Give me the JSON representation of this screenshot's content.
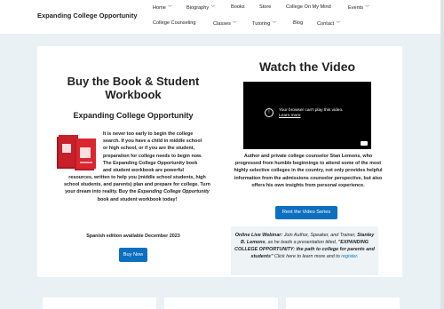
{
  "site": {
    "title": "Expanding College Opportunity"
  },
  "nav": {
    "row1": [
      {
        "label": "Home",
        "dropdown": true
      },
      {
        "label": "Biography",
        "dropdown": true
      },
      {
        "label": "Books",
        "dropdown": false
      },
      {
        "label": "Store",
        "dropdown": false
      },
      {
        "label": "College On My Mind",
        "dropdown": false
      },
      {
        "label": "Events",
        "dropdown": true
      }
    ],
    "row2": [
      {
        "label": "College Counseling",
        "dropdown": false
      },
      {
        "label": "Classes",
        "dropdown": true
      },
      {
        "label": "Tutoring",
        "dropdown": true
      },
      {
        "label": "Blog",
        "dropdown": false
      },
      {
        "label": "Contact",
        "dropdown": true
      }
    ]
  },
  "left": {
    "heading": "Buy the Book & Student Workbook",
    "subheading": "Expanding College Opportunity",
    "body_lines": [
      "It is never too early to begin the college",
      "search. If you have a child in middle school",
      "or high school, or if you are the student,",
      "preparation for college needs to begin now.",
      "The Expanding College Opportunity book",
      "and student workbook are powerful"
    ],
    "body_wide": [
      "resources, written to help you (middle school students, high",
      "school students, and parents) plan and prepare for college. Turn",
      "your dream into reality. Buy the"
    ],
    "body_italic": "Expanding College Opportunity",
    "body_end": "book and student workbook today!",
    "spanish_note": "Spanish edition available December 2023",
    "buy_button": "Buy Now"
  },
  "right": {
    "heading": "Watch the Video",
    "video_message": "Your browser can't play this video.",
    "video_link": "Learn more",
    "description_lines": [
      "Author and private college counselor Stan Lemons, who",
      "progressed from humble beginnings to attend some of the most",
      "highly selective colleges in the country, not only provides helpful",
      "information from the admissions counselor perspective, but also",
      "offers his own insights from personal experience."
    ],
    "rent_button": "Rent the Video Series",
    "webinar": {
      "lead": "Online Live Webinar:",
      "line1_rest": " Join Author, Speaker, and Trainer,",
      "name": "Stanley B. Lemons",
      "line2_rest": ", as he leads a presentation titled,",
      "title": "\"EXPANDING COLLEGE OPPORTUNITY: the path to college for parents and students\"",
      "cta_pre": " Click here to learn more and to ",
      "cta_link": "register",
      "cta_end": "."
    }
  },
  "colors": {
    "accent": "#0d6fc0",
    "background": "#e9f1f4",
    "book": "#c8202a"
  }
}
